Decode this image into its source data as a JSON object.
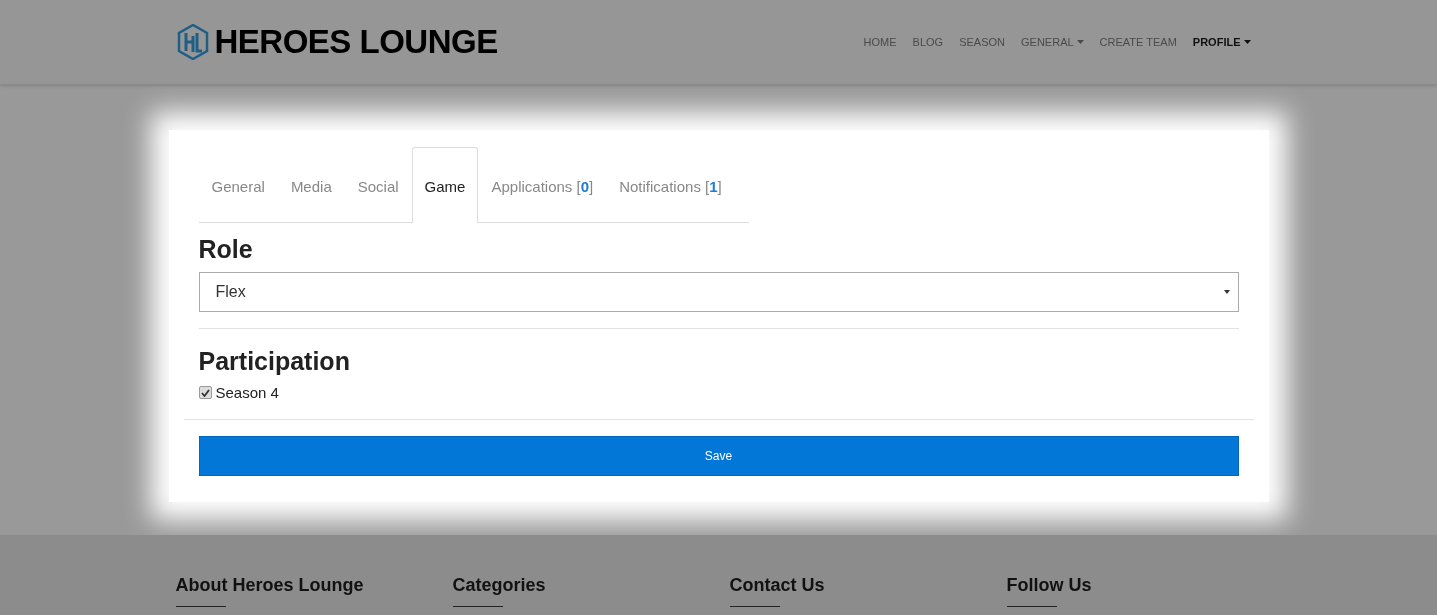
{
  "header": {
    "logo_text": "HEROES LOUNGE",
    "nav": [
      {
        "label": "HOME",
        "dropdown": false,
        "selected": false
      },
      {
        "label": "BLOG",
        "dropdown": false,
        "selected": false
      },
      {
        "label": "SEASON",
        "dropdown": false,
        "selected": false
      },
      {
        "label": "GENERAL",
        "dropdown": true,
        "selected": false
      },
      {
        "label": "CREATE TEAM",
        "dropdown": false,
        "selected": false
      },
      {
        "label": "PROFILE",
        "dropdown": true,
        "selected": true
      }
    ]
  },
  "dialog": {
    "tabs": [
      {
        "label": "General",
        "selected": false
      },
      {
        "label": "Media",
        "selected": false
      },
      {
        "label": "Social",
        "selected": false
      },
      {
        "label": "Game",
        "selected": true
      },
      {
        "label": "Applications [**0**]",
        "selected": false
      },
      {
        "label": "Notifications [**1**]",
        "selected": false
      }
    ],
    "role": {
      "heading": "Role",
      "value": "Flex"
    },
    "participation": {
      "heading": "Participation",
      "options": [
        {
          "label": "Season 4",
          "checked": true
        }
      ]
    },
    "save_button": "Save"
  },
  "footer": {
    "headings": [
      "About Heroes Lounge",
      "Categories",
      "Contact Us",
      "Follow Us"
    ]
  }
}
